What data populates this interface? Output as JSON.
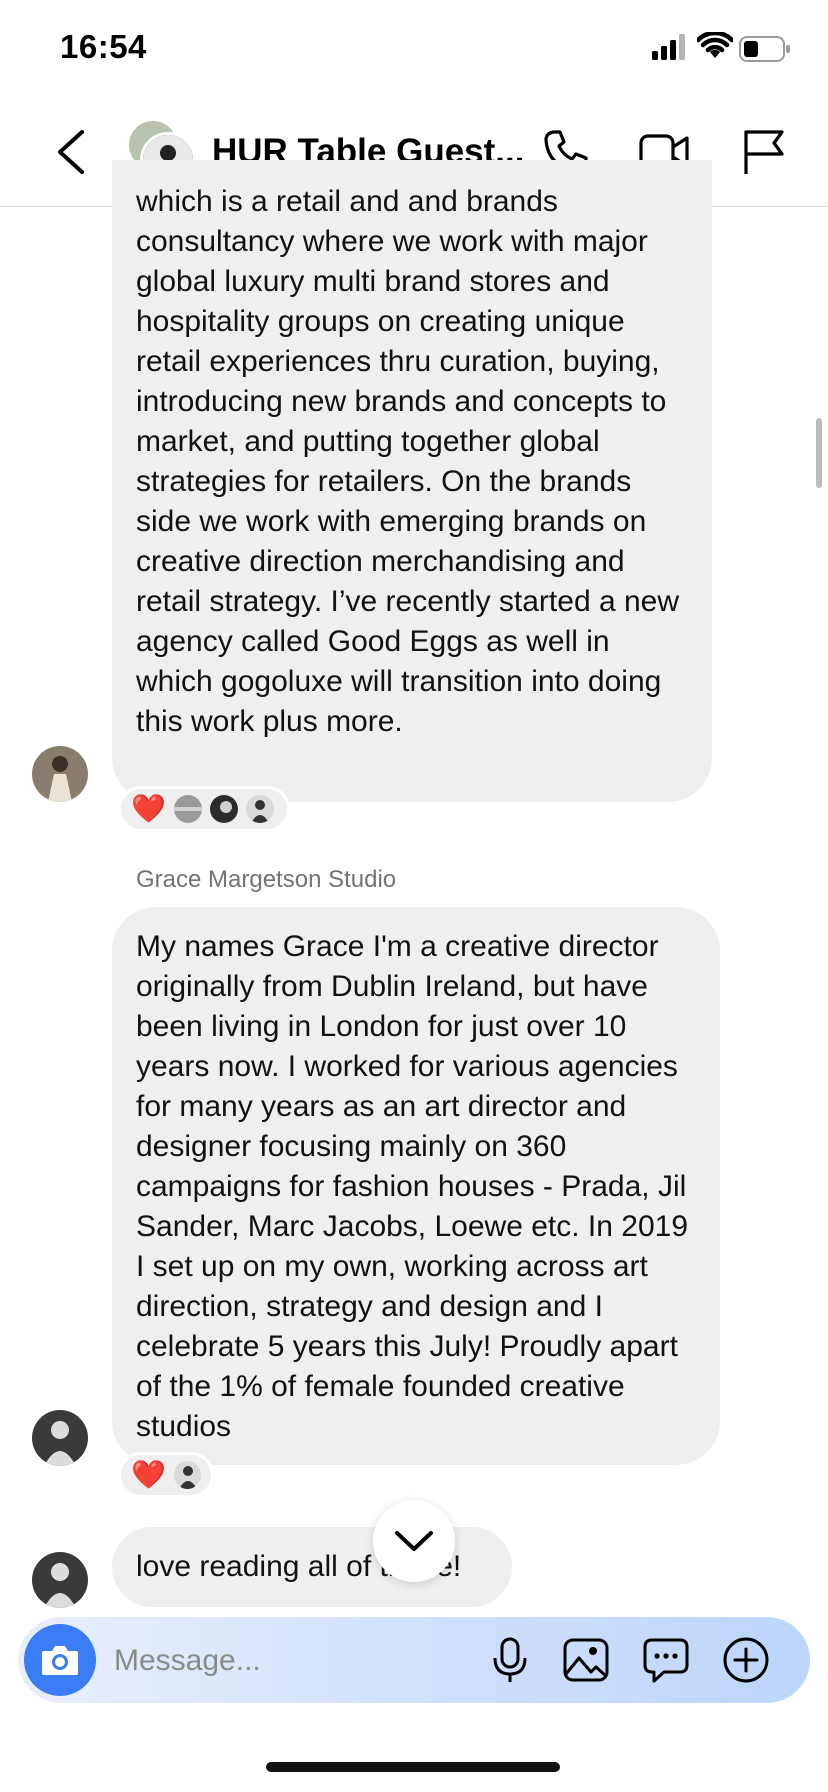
{
  "status_bar": {
    "time": "16:54"
  },
  "header": {
    "title": "HUR Table Guest...",
    "back_icon": "chevron-left-icon",
    "call_icon": "phone-icon",
    "video_icon": "video-camera-icon",
    "report_icon": "flag-icon"
  },
  "messages": [
    {
      "text": "which is a retail and and brands consultancy where we work with major global luxury multi brand stores and hospitality groups on creating unique retail experiences thru curation, buying, introducing new brands and concepts to market, and putting together global strategies for retailers. On the brands side we work with emerging brands on creative direction merchandising and retail strategy. I’ve recently started a new agency called Good Eggs as well in which gogoluxe will transition into doing this work plus more.",
      "reaction": "❤️"
    },
    {
      "sender": "Grace Margetson Studio",
      "text": "My names Grace I'm a creative director originally from Dublin Ireland, but have been living in London for just over 10 years now. I worked for various agencies for many years as an art director and designer focusing mainly on 360 campaigns for fashion houses - Prada, Jil Sander, Marc Jacobs, Loewe etc. In 2019 I set up on my own, working across art direction, strategy and design and I celebrate 5 years this July! Proudly apart of the 1% of female founded creative studios",
      "reaction": "❤️"
    },
    {
      "text": "love reading all of these!"
    }
  ],
  "composer": {
    "placeholder": "Message..."
  },
  "colors": {
    "bubble": "#efefef",
    "accent": "#3b7df4",
    "heart": "#e0245e"
  }
}
